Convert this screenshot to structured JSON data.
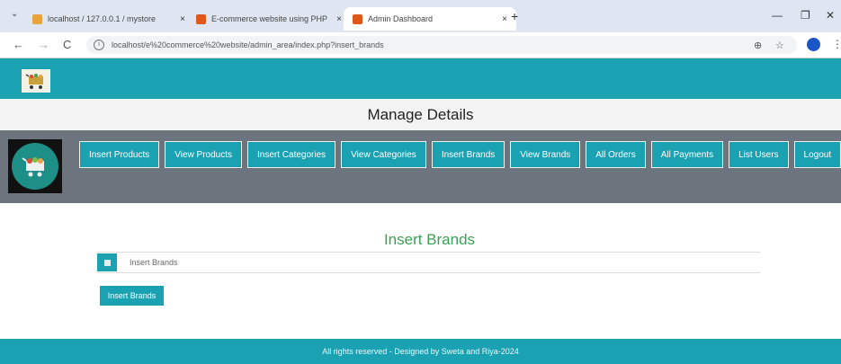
{
  "browser": {
    "tabs": [
      {
        "title": "localhost / 127.0.0.1 / mystore",
        "favicon_color": "#e8a33a"
      },
      {
        "title": "E-commerce website using PHP",
        "favicon_color": "#e0571b"
      },
      {
        "title": "Admin Dashboard",
        "favicon_color": "#e0571b"
      }
    ],
    "tab_close": "×",
    "new_tab": "+",
    "url": "localhost/e%20commerce%20website/admin_area/index.php?insert_brands",
    "nav": {
      "back": "←",
      "forward": "→",
      "reload": "C"
    },
    "zoom_icon": "⊕",
    "star_icon": "☆",
    "menu_dots": "⋮",
    "window": {
      "minimize": "—",
      "restore": "❐",
      "close": "✕"
    },
    "tab_down": "⌄"
  },
  "page": {
    "manage_title": "Manage Details",
    "nav_buttons": [
      "Insert Products",
      "View Products",
      "Insert Categories",
      "View Categories",
      "Insert Brands",
      "View Brands",
      "All Orders",
      "All Payments",
      "List Users",
      "Logout"
    ],
    "form_title": "Insert Brands",
    "form_placeholder": "Insert Brands",
    "submit_label": "Insert Brands",
    "footer": "All rights reserved - Designed by Sweta and Riya-2024"
  },
  "colors": {
    "teal": "#1aa1b2",
    "gray_bar": "#6c757d",
    "title_green": "#3aa055"
  }
}
